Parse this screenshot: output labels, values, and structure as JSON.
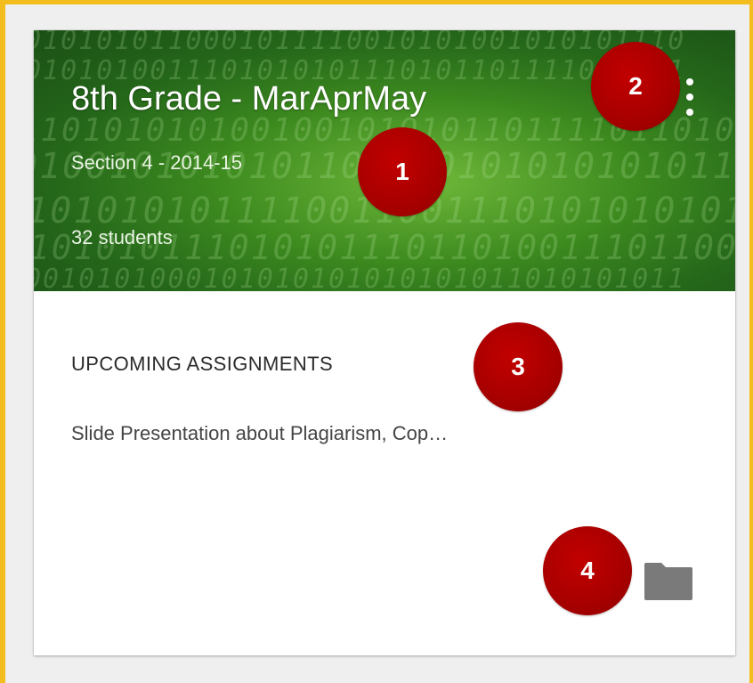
{
  "class_card": {
    "title": "8th Grade - MarAprMay",
    "section": "Section 4 - 2014-15",
    "students": "32 students",
    "upcoming_heading": "UPCOMING ASSIGNMENTS",
    "assignment": "Slide Presentation about Plagiarism, Cop…",
    "menu_icon": "more-vert-icon",
    "folder_icon": "folder-icon"
  },
  "callouts": [
    "1",
    "2",
    "3",
    "4"
  ],
  "colors": {
    "page_border": "#f4bd1e",
    "background": "#efefef",
    "card": "#ffffff",
    "header_green": "#2d7a1e",
    "callout_red": "#a60000",
    "folder_gray": "#7a7a7a"
  }
}
